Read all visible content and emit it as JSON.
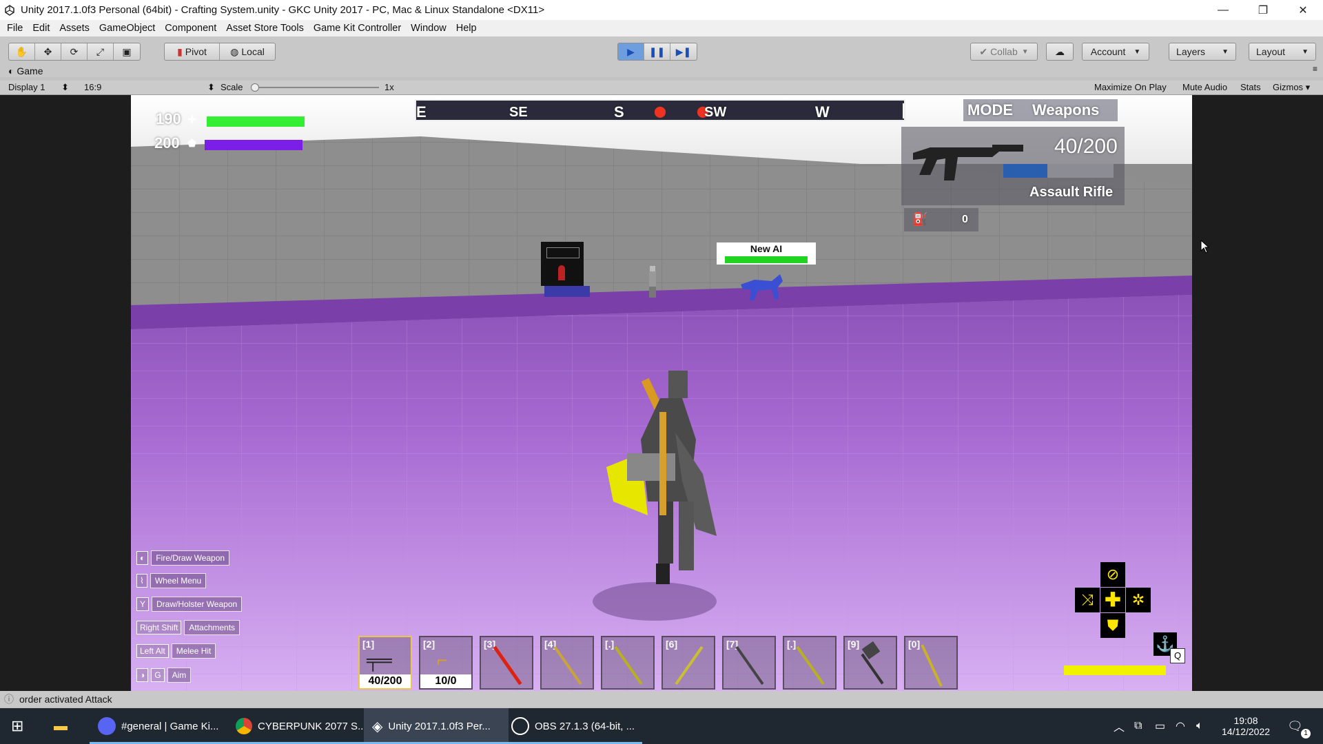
{
  "window": {
    "title": "Unity 2017.1.0f3 Personal (64bit) - Crafting System.unity - GKC Unity 2017 - PC, Mac & Linux Standalone <DX11>",
    "controls": [
      "—",
      "❐",
      "✕"
    ]
  },
  "menu": [
    "File",
    "Edit",
    "Assets",
    "GameObject",
    "Component",
    "Asset Store Tools",
    "Game Kit Controller",
    "Window",
    "Help"
  ],
  "toolbar": {
    "pivot": "Pivot",
    "local": "Local",
    "collab": "Collab",
    "account": "Account",
    "layers": "Layers",
    "layout": "Layout",
    "accent_color": "#6e9ede"
  },
  "game_panel": {
    "tab": "Game",
    "display": "Display 1",
    "aspect": "16:9",
    "scale_label": "Scale",
    "scale_value": "1x",
    "maximize": "Maximize On Play",
    "mute": "Mute Audio",
    "stats": "Stats",
    "gizmos": "Gizmos"
  },
  "hud": {
    "health_value": "190",
    "health_color": "#33ee33",
    "shield_value": "200",
    "shield_color": "#7a1ee8",
    "compass": [
      "E",
      "SE",
      "S",
      "SW",
      "W"
    ],
    "mode_label": "MODE",
    "mode_value": "Weapons",
    "ammo": "40/200",
    "weapon_name": "Assault Rifle",
    "grenade_count": "0",
    "enemy_name": "New AI",
    "enemy_health_fraction": 1.0,
    "stamina_color": "#f2f200",
    "controls": [
      {
        "key": "",
        "label": "Fire/Draw Weapon"
      },
      {
        "key": "",
        "label": "Wheel Menu"
      },
      {
        "key": "Y",
        "label": "Draw/Holster Weapon"
      },
      {
        "key": "Right Shift",
        "label": "Attachments"
      },
      {
        "key": "Left Alt",
        "label": "Melee Hit"
      },
      {
        "key": "G",
        "label": "Aim"
      }
    ],
    "slots": [
      {
        "num": "[1]",
        "amount": "40/200",
        "item": "rifle-icon"
      },
      {
        "num": "[2]",
        "amount": "10/0",
        "item": "pistol-icon"
      },
      {
        "num": "[3]",
        "amount": "",
        "item": "red-staff-icon"
      },
      {
        "num": "[4]",
        "amount": "",
        "item": "axe-icon"
      },
      {
        "num": "[.]",
        "amount": "",
        "item": "sword-icon"
      },
      {
        "num": "[6]",
        "amount": "",
        "item": "sword-icon"
      },
      {
        "num": "[7]",
        "amount": "",
        "item": "shovel-icon"
      },
      {
        "num": "[.]",
        "amount": "",
        "item": "sword-icon"
      },
      {
        "num": "[9]",
        "amount": "",
        "item": "hammer-icon"
      },
      {
        "num": "[0]",
        "amount": "",
        "item": "pickaxe-icon"
      }
    ],
    "power_key": "Q"
  },
  "status": "order activated Attack",
  "taskbar": {
    "apps": [
      "#general | Game Ki...",
      "CYBERPUNK 2077 S...",
      "Unity 2017.1.0f3 Per...",
      "OBS 27.1.3 (64-bit, ..."
    ],
    "time": "19:08",
    "date": "14/12/2022",
    "notif": "1"
  }
}
